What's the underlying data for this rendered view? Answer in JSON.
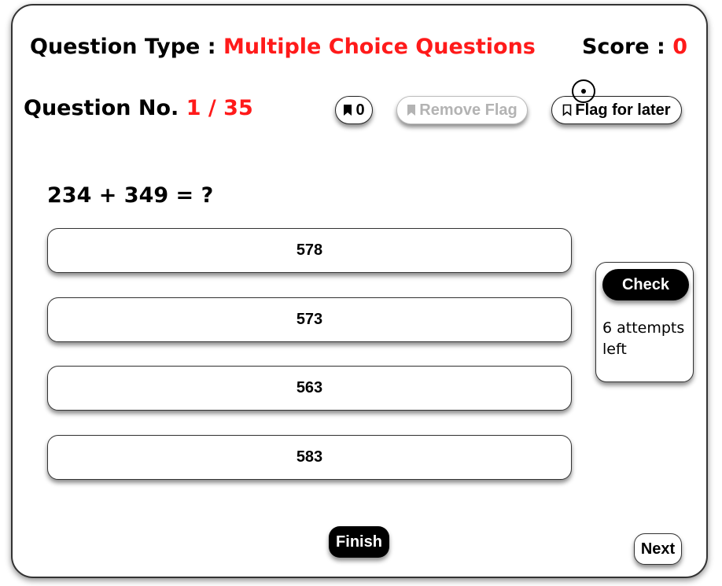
{
  "header": {
    "question_type_label": "Question Type : ",
    "question_type_value": "Multiple Choice Questions",
    "score_label": "Score : ",
    "score_value": "0"
  },
  "question_info": {
    "label": "Question No. ",
    "current": "1",
    "separator": " / ",
    "total": "35"
  },
  "flags": {
    "count": "0",
    "remove_label": "Remove Flag",
    "flag_later_label": "Flag for later",
    "count_icon": "bookmark-filled-icon",
    "remove_icon": "bookmark-filled-icon",
    "flag_later_icon": "bookmark-outline-icon"
  },
  "question": {
    "text": "234 + 349 = ?",
    "options": [
      "578",
      "573",
      "563",
      "583"
    ]
  },
  "check": {
    "button_label": "Check",
    "attempts_text": "6 attempts left"
  },
  "footer": {
    "finish_label": "Finish",
    "next_label": "Next"
  },
  "colors": {
    "accent_red": "#ff1a1a",
    "disabled_gray": "#b3b3b3"
  }
}
